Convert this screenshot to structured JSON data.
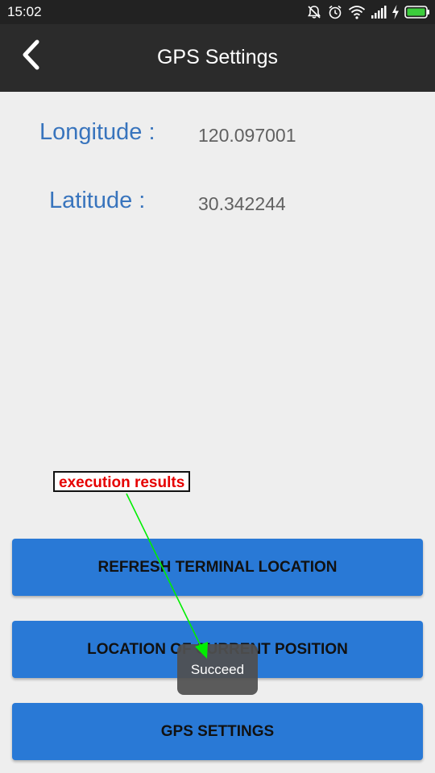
{
  "status_bar": {
    "time": "15:02"
  },
  "app_bar": {
    "title": "GPS Settings"
  },
  "coordinates": {
    "longitude_label": "Longitude :",
    "longitude_value": "120.097001",
    "latitude_label": "Latitude :",
    "latitude_value": "30.342244"
  },
  "annotation": {
    "label": "execution results",
    "label_color": "#e60000",
    "arrow_color": "#00ee00"
  },
  "buttons": {
    "refresh_label": "REFRESH TERMINAL LOCATION",
    "current_position_label": "LOCATION OF CURRENT POSITION",
    "gps_settings_label": "GPS SETTINGS"
  },
  "toast": {
    "message": "Succeed"
  },
  "colors": {
    "accent_blue": "#2979d6",
    "label_blue": "#3874bd",
    "app_bar": "#2b2b2b",
    "status_bar": "#222222"
  }
}
